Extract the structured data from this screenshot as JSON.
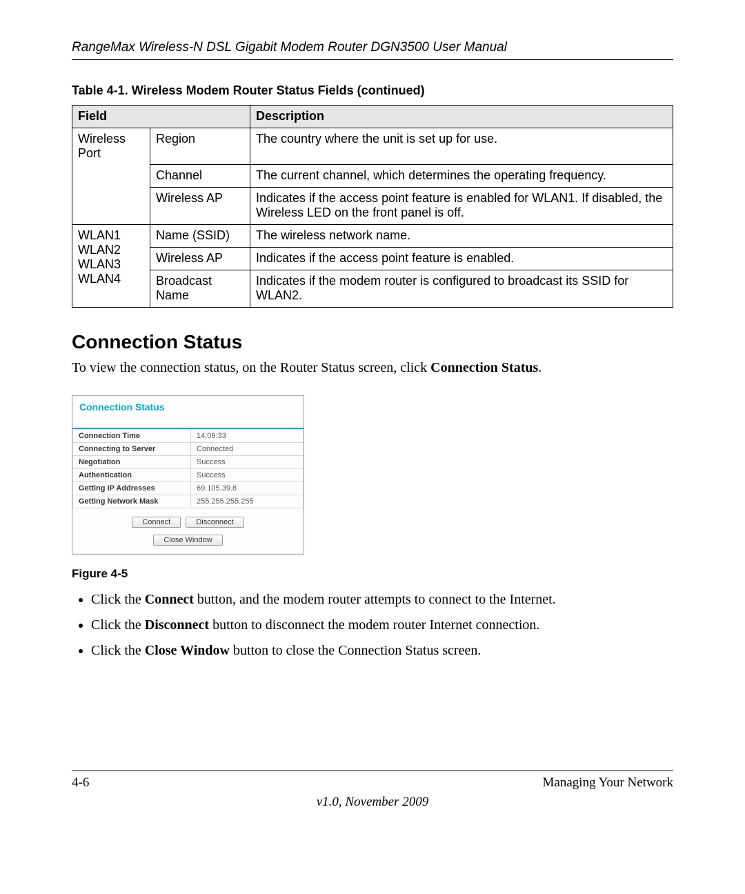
{
  "header": {
    "title": "RangeMax Wireless-N DSL Gigabit Modem Router DGN3500 User Manual"
  },
  "table": {
    "caption": "Table 4-1.  Wireless Modem Router Status Fields (continued)",
    "head": {
      "field": "Field",
      "desc": "Description"
    },
    "group1": {
      "outer": "Wireless\nPort",
      "rows": [
        {
          "sub": "Region",
          "desc": "The country where the unit is set up for use."
        },
        {
          "sub": "Channel",
          "desc": "The current channel, which determines the operating frequency."
        },
        {
          "sub": "Wireless AP",
          "desc": "Indicates if the access point feature is enabled for WLAN1. If disabled, the Wireless LED on the front panel is off."
        }
      ]
    },
    "group2": {
      "outer": "WLAN1\nWLAN2\nWLAN3\nWLAN4",
      "rows": [
        {
          "sub": "Name (SSID)",
          "desc": "The wireless network name."
        },
        {
          "sub": "Wireless AP",
          "desc": "Indicates if the access point feature is enabled."
        },
        {
          "sub": "Broadcast Name",
          "desc": "Indicates if the modem router is configured to broadcast its SSID for WLAN2."
        }
      ]
    }
  },
  "section": {
    "title": "Connection Status"
  },
  "intro": {
    "pre": "To view the connection status, on the Router Status screen, click ",
    "bold": "Connection Status",
    "post": "."
  },
  "dialog": {
    "title": "Connection Status",
    "rows": [
      {
        "k": "Connection Time",
        "v": "14:09:33"
      },
      {
        "k": "Connecting to Server",
        "v": "Connected"
      },
      {
        "k": "Negotiation",
        "v": "Success"
      },
      {
        "k": "Authentication",
        "v": "Success"
      },
      {
        "k": "Getting IP Addresses",
        "v": "69.105.39.8"
      },
      {
        "k": "Getting Network Mask",
        "v": "255.255.255.255"
      }
    ],
    "buttons": {
      "connect": "Connect",
      "disconnect": "Disconnect",
      "close": "Close Window"
    }
  },
  "figure": {
    "label": "Figure 4-5"
  },
  "bullets": [
    {
      "pre": "Click the ",
      "bold": "Connect",
      "post": " button, and the modem router attempts to connect to the Internet."
    },
    {
      "pre": "Click the ",
      "bold": "Disconnect",
      "post": " button to disconnect the modem router Internet connection."
    },
    {
      "pre": "Click the ",
      "bold": "Close Window",
      "post": " button to close the Connection Status screen."
    }
  ],
  "footer": {
    "left": "4-6",
    "right": "Managing Your Network",
    "center": "v1.0, November 2009"
  }
}
